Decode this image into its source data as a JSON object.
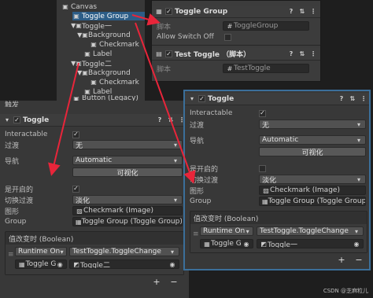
{
  "hierarchy": {
    "items": [
      {
        "label": "Canvas"
      },
      {
        "label": "Toggle Group"
      },
      {
        "label": "Toggle一"
      },
      {
        "label": "Background"
      },
      {
        "label": "Checkmark"
      },
      {
        "label": "Label"
      },
      {
        "label": "Toggle二"
      },
      {
        "label": "Background"
      },
      {
        "label": "Checkmark"
      },
      {
        "label": "Label"
      },
      {
        "label": "Button (Legacy)"
      }
    ]
  },
  "topright": {
    "toggle_group_title": "Toggle Group",
    "script_label": "脚本",
    "script_value": "ToggleGroup",
    "allow_switch_off_label": "Allow Switch Off",
    "test_toggle_title": "Test Toggle （脚本）",
    "test_script_label": "脚本",
    "test_script_value": "TestToggle"
  },
  "left_inspector": {
    "top_clip_label": "触发",
    "title": "Toggle",
    "interactable_label": "Interactable",
    "transition_label": "过渡",
    "transition_value": "无",
    "navigation_label": "导航",
    "navigation_value": "Automatic",
    "visualize_button": "可视化",
    "is_on_label": "是开启的",
    "toggle_transition_label": "切换过渡",
    "toggle_transition_value": "淡化",
    "graphic_label": "图形",
    "graphic_value": "Checkmark (Image)",
    "group_label": "Group",
    "group_value": "Toggle Group (Toggle Group)",
    "event_label": "值改变时 (Boolean)",
    "runtime_value": "Runtime On",
    "function_value": "TestToggle.ToggleChange",
    "object_value": "Toggle G",
    "arg_value": "Toggle二",
    "plus": "+",
    "minus": "−"
  },
  "right_inspector": {
    "title": "Toggle",
    "interactable_label": "Interactable",
    "transition_label": "过渡",
    "transition_value": "无",
    "navigation_label": "导航",
    "navigation_value": "Automatic",
    "visualize_button": "可视化",
    "is_on_label": "是开启的",
    "toggle_transition_label": "切换过渡",
    "toggle_transition_value": "淡化",
    "graphic_label": "图形",
    "graphic_value": "Checkmark (Image)",
    "group_label": "Group",
    "group_value": "Toggle Group (Toggle Group)",
    "event_label": "值改变时 (Boolean)",
    "runtime_value": "Runtime On",
    "function_value": "TestToggle.ToggleChange",
    "object_value": "Toggle G",
    "arg_value": "Toggle一",
    "plus": "+",
    "minus": "−"
  },
  "watermark": "CSDN @芝麻粒儿",
  "colors": {
    "arrow": "#e8253a",
    "highlight_border": "#3b6f9a",
    "selection": "#2c5d87"
  }
}
